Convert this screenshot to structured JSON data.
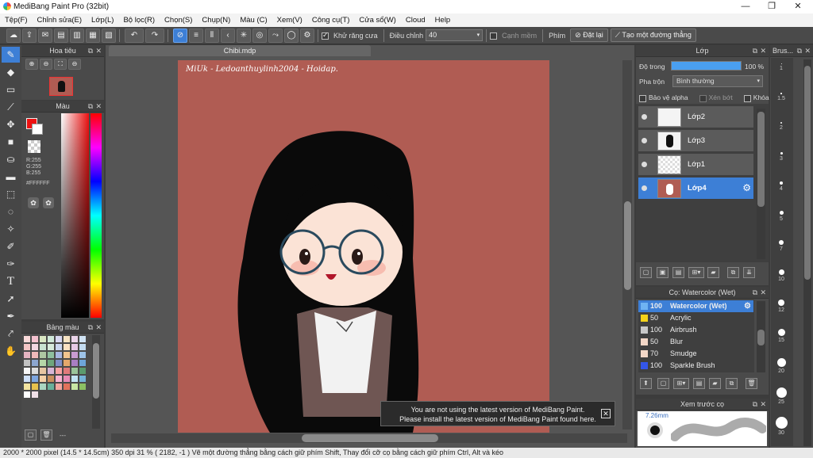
{
  "window": {
    "title": "MediBang Paint Pro (32bit)",
    "min": "—",
    "max": "❐",
    "close": "✕"
  },
  "menu": [
    "Tệp(F)",
    "Chỉnh sửa(E)",
    "Lớp(L)",
    "Bộ lọc(R)",
    "Chọn(S)",
    "Chụp(N)",
    "Màu (C)",
    "Xem(V)",
    "Công cụ(T)",
    "Cửa sổ(W)",
    "Cloud",
    "Help"
  ],
  "toolbar": {
    "antialias_label": "Khử răng cưa",
    "adjust_label": "Điều chỉnh",
    "adjust_value": "40",
    "edge_label": "Cạnh mềm",
    "key_label": "Phím",
    "reset_label": "Đặt lại",
    "line_label": "Tạo một đường thẳng"
  },
  "navigator": {
    "title": "Hoa tiêu"
  },
  "color": {
    "title": "Màu",
    "r": "R:255",
    "g": "G:255",
    "b": "B:255",
    "hex": "#FFFFFF"
  },
  "palette": {
    "title": "Bảng màu",
    "footer": "---",
    "colors": [
      "#f9d9d9",
      "#f3c1cf",
      "#d9e7c2",
      "#cfe8d8",
      "#d8d8f1",
      "#f6e3c3",
      "#ead4e9",
      "#cfe2f3",
      "#f5c6c6",
      "#f2d7e3",
      "#c9e3d1",
      "#d6eadb",
      "#cad5ef",
      "#fbe1c2",
      "#e6c9e6",
      "#c3dcf1",
      "#e5b4c1",
      "#f0b9b9",
      "#aec6a3",
      "#8fbf9f",
      "#a7b6e1",
      "#f2c48e",
      "#c89bd1",
      "#9dc3e8",
      "#c1c1c1",
      "#8ca6cf",
      "#b6d7a8",
      "#6fa67d",
      "#7f8fc6",
      "#e4a86b",
      "#a97ec3",
      "#6ea5da",
      "#f7f7f7",
      "#dcdcdc",
      "#e7c6a2",
      "#d7b6d7",
      "#f5a3a3",
      "#e07a7a",
      "#9ac49a",
      "#5b9a6d",
      "#cfe0f7",
      "#7da6e0",
      "#f4d0a6",
      "#c98f5e",
      "#f8b4d2",
      "#e88bb5",
      "#c2e4f4",
      "#75b3d8",
      "#f3e4a1",
      "#e6c14d",
      "#aad6c1",
      "#69b09a",
      "#f3a7a0",
      "#e2725b",
      "#c7e6a4",
      "#8cc063",
      "#ffffff",
      "#f0e0e8"
    ]
  },
  "canvas": {
    "tab": "Chibi.mdp",
    "signature": "MiUk - Ledoanthuylinh2004 - Hoidap."
  },
  "notice": {
    "line1": "You are not using the latest version of MediBang Paint.",
    "line2": "Please install the latest version of MediBang Paint found here."
  },
  "layers": {
    "title": "Lớp",
    "opacity_label": "Độ trong",
    "opacity_value": "100 %",
    "opacity": 1.0,
    "blend_label": "Pha trộn",
    "blend_value": "Bình thường",
    "protect_alpha": "Bảo vệ alpha",
    "clip": "Xén bớt",
    "lock": "Khóa",
    "items": [
      {
        "name": "Lớp2"
      },
      {
        "name": "Lớp3"
      },
      {
        "name": "Lớp1"
      },
      {
        "name": "Lớp4"
      }
    ]
  },
  "brushes": {
    "title": "Cọ: Watercolor (Wet)",
    "items": [
      {
        "size": "100",
        "name": "Watercolor (Wet)",
        "color": "#6fb3f2"
      },
      {
        "size": "50",
        "name": "Acrylic",
        "color": "#f3d21b"
      },
      {
        "size": "100",
        "name": "Airbrush",
        "color": "#c8c8c8"
      },
      {
        "size": "50",
        "name": "Blur",
        "color": "#f3d7c7"
      },
      {
        "size": "70",
        "name": "Smudge",
        "color": "#f3d7c7"
      },
      {
        "size": "100",
        "name": "Sparkle Brush",
        "color": "#3456e8"
      }
    ]
  },
  "preview": {
    "title": "Xem trước cọ",
    "size": "7.26mm"
  },
  "brushsize": {
    "title": "Brus...",
    "labels": [
      "1",
      "1.5",
      "2",
      "3",
      "4",
      "5",
      "7",
      "10",
      "12",
      "15",
      "20",
      "25",
      "30"
    ]
  },
  "status": "2000 * 2000 pixel   (14.5 * 14.5cm)   350 dpi   31 %   ( 2182, -1 )   Vẽ một đường thẳng bằng cách giữ phím Shift, Thay đổi cỡ cọ bằng cách giữ phím Ctrl, Alt và kéo"
}
